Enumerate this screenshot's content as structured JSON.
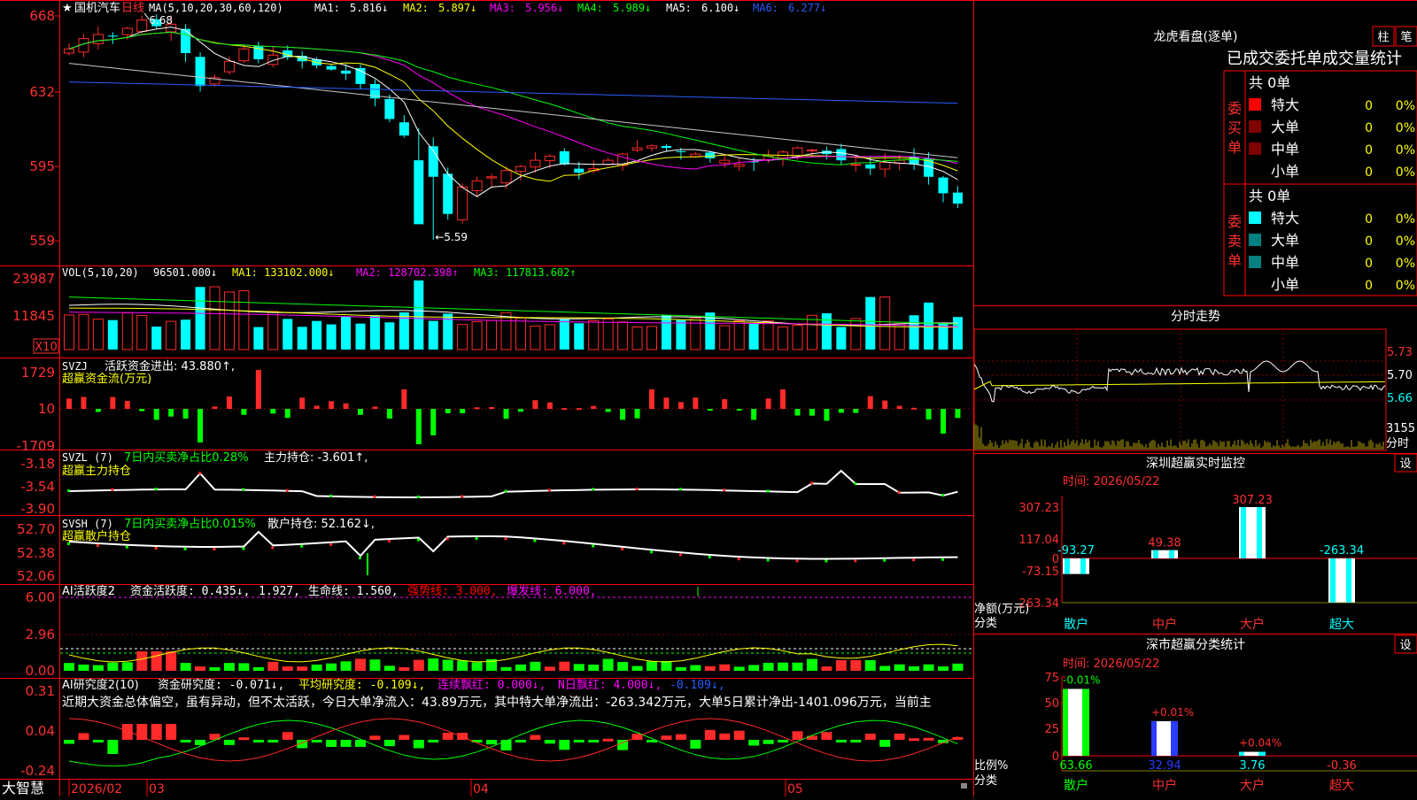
{
  "colors": {
    "up": "#ff2a2a",
    "down": "#00ffff",
    "grid": "#c00000",
    "frame": "#ff0000",
    "ma1": "#ffffff",
    "ma2": "#ffff00",
    "ma3": "#ff00ff",
    "ma4": "#00ff00",
    "ma5": "#c8c8c8",
    "ma6": "#2a5cff",
    "green": "#00ff00",
    "yellow": "#ffff00",
    "magenta": "#ff00ff"
  },
  "header": {
    "star": "★",
    "stock_name": "国机汽车",
    "period": "日线",
    "ma_label": "MA(5,10,20,30,60,120)",
    "ma": [
      {
        "label": "MA1:",
        "value": "5.816↓"
      },
      {
        "label": "MA2:",
        "value": "5.897↓"
      },
      {
        "label": "MA3:",
        "value": "5.956↓"
      },
      {
        "label": "MA4:",
        "value": "5.989↓"
      },
      {
        "label": "MA5:",
        "value": "6.100↓"
      },
      {
        "label": "MA6:",
        "value": "6.277↓"
      }
    ],
    "high_mark": "6.68",
    "low_mark": "←5.59"
  },
  "price_axis": [
    "668",
    "632",
    "595",
    "559"
  ],
  "vol": {
    "title": "VOL(5,10,20)",
    "value": "96501.000↓",
    "ma1": "MA1: 133102.000↓",
    "ma2": "MA2: 128702.398↑",
    "ma3": "MA3: 117813.602↑",
    "axis": [
      "23987",
      "11845"
    ],
    "unit": "X10"
  },
  "svzj": {
    "title": "SVZJ",
    "text": "活跃资金进出: 43.880↑,",
    "sub": "超赢资金流(万元)",
    "axis": [
      "1729",
      "10",
      "-1709"
    ]
  },
  "svzl": {
    "title": "SVZL (7)",
    "green": "7日内买卖净占比0.28%",
    "white": "主力持仓: -3.601↑,",
    "sub": "超赢主力持仓",
    "axis": [
      "-3.18",
      "-3.54",
      "-3.90"
    ]
  },
  "svsh": {
    "title": "SVSH (7)",
    "green": "7日内买卖净占比0.015%",
    "white": "散户持仓: 52.162↓,",
    "sub": "超赢散户持仓",
    "axis": [
      "52.70",
      "52.38",
      "52.06"
    ]
  },
  "ai1": {
    "title": "AI活跃度2",
    "t1": "资金活跃度: 0.435↓,",
    "t2": "1.927,",
    "t3": "生命线: 1.560,",
    "t4": "强势线: 3.000,",
    "t5": "爆发线: 6.000,",
    "axis": [
      "6.00",
      "2.96",
      "0.00"
    ]
  },
  "ai2": {
    "title": "AI研究度2(10)",
    "t1": "资金研究度: -0.071↓,",
    "t2": "平均研究度: -0.109↓,",
    "t3": "连续飘红: 0.000↓,",
    "t4": "N日飘红: 4.000↓,",
    "t5": "-0.109↓,",
    "summary": "近期大资金总体偏空，虽有异动，但不太活跃，今日大单净流入：43.89万元，其中特大单净流出：-263.342万元，大单5日累计净出-1401.096万元，当前主",
    "axis": [
      "0.31",
      "0.04",
      "-0.24"
    ]
  },
  "date_axis": {
    "logo": "大智慧",
    "labels": [
      "2026/02",
      "03",
      "04",
      "05"
    ]
  },
  "right": {
    "dragon_title": "龙虎看盘(逐单)",
    "btn_bar": "柱",
    "btn_pen": "笔",
    "stats_title": "已成交委托单成交量统计",
    "buy": {
      "label": "委买单",
      "total": "共 0单",
      "rows": [
        {
          "name": "特大",
          "count": "0",
          "pct": "0%"
        },
        {
          "name": "大单",
          "count": "0",
          "pct": "0%"
        },
        {
          "name": "中单",
          "count": "0",
          "pct": "0%"
        },
        {
          "name": "小单",
          "count": "0",
          "pct": "0%"
        }
      ]
    },
    "sell": {
      "label": "委卖单",
      "total": "共 0单",
      "rows": [
        {
          "name": "特大",
          "count": "0",
          "pct": "0%"
        },
        {
          "name": "大单",
          "count": "0",
          "pct": "0%"
        },
        {
          "name": "中单",
          "count": "0",
          "pct": "0%"
        },
        {
          "name": "小单",
          "count": "0",
          "pct": "0%"
        }
      ]
    },
    "intraday": {
      "title": "分时走势",
      "prices": [
        "5.73",
        "5.70",
        "5.66"
      ],
      "vol": "3155",
      "unit": "分时"
    },
    "sz_monitor": {
      "title": "深圳超赢实时监控",
      "btn": "设",
      "time": "时间: 2026/05/22",
      "axis": [
        "307.23",
        "117.04",
        "0",
        "-73.15",
        "-263.34"
      ],
      "ylabel": "净额(万元)",
      "xlabel": "分类",
      "categories": [
        "散户",
        "中户",
        "大户",
        "超大"
      ],
      "values": [
        -93.27,
        49.38,
        307.23,
        -263.34
      ],
      "value_labels": [
        "-93.27",
        "49.38",
        "307.23",
        "-263.34"
      ]
    },
    "sz_class": {
      "title": "深市超赢分类统计",
      "btn": "设",
      "time": "时间: 2026/05/22",
      "axis": [
        "75",
        "50",
        "25",
        "0"
      ],
      "ylabel": "比例%",
      "xlabel": "分类",
      "categories": [
        "散户",
        "中户",
        "大户",
        "超大"
      ],
      "values": [
        63.66,
        32.94,
        3.76,
        -0.36
      ],
      "value_labels": [
        "63.66",
        "32.94",
        "3.76",
        "-0.36"
      ],
      "change_labels": [
        "-0.01%",
        "+0.01%",
        "+0.04%",
        ""
      ]
    }
  }
}
